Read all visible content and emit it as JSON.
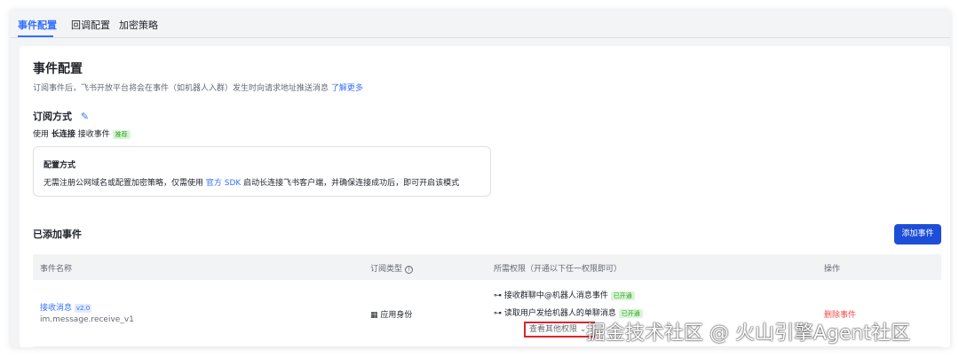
{
  "tabs": [
    "事件配置",
    "回调配置",
    "加密策略"
  ],
  "title": "事件配置",
  "description": "订阅事件后，飞书开放平台将会在事件（如机器人入群）发生时向请求地址推送消息",
  "learn_more": "了解更多",
  "subscribe": {
    "label": "订阅方式",
    "use": "使用",
    "mode": "长连接",
    "receive": "接收事件",
    "badge": "推荐"
  },
  "config": {
    "title": "配置方式",
    "text_before": "无需注册公网域名或配置加密策略，仅需使用",
    "sdk_link": "官方 SDK",
    "text_after": "启动长连接飞书客户端，并确保连接成功后，即可开启该模式"
  },
  "added": {
    "title": "已添加事件",
    "add_button": "添加事件"
  },
  "table": {
    "headers": [
      "事件名称",
      "订阅类型",
      "所需权限（开通以下任一权限即可）",
      "操作"
    ],
    "header_help_icon": "?",
    "rows": [
      {
        "name": "接收消息",
        "version": "v2.0",
        "key": "im.message.receive_v1",
        "type": "应用身份",
        "permissions": [
          {
            "label": "接收群聊中@机器人消息事件",
            "status": "已开通"
          },
          {
            "label": "读取用户发给机器人的单聊消息",
            "status": "已开通"
          }
        ],
        "more": "查看其他权限",
        "action": "删除事件"
      }
    ]
  },
  "watermark": "掘金技术社区 @ 火山引擎Agent社区"
}
